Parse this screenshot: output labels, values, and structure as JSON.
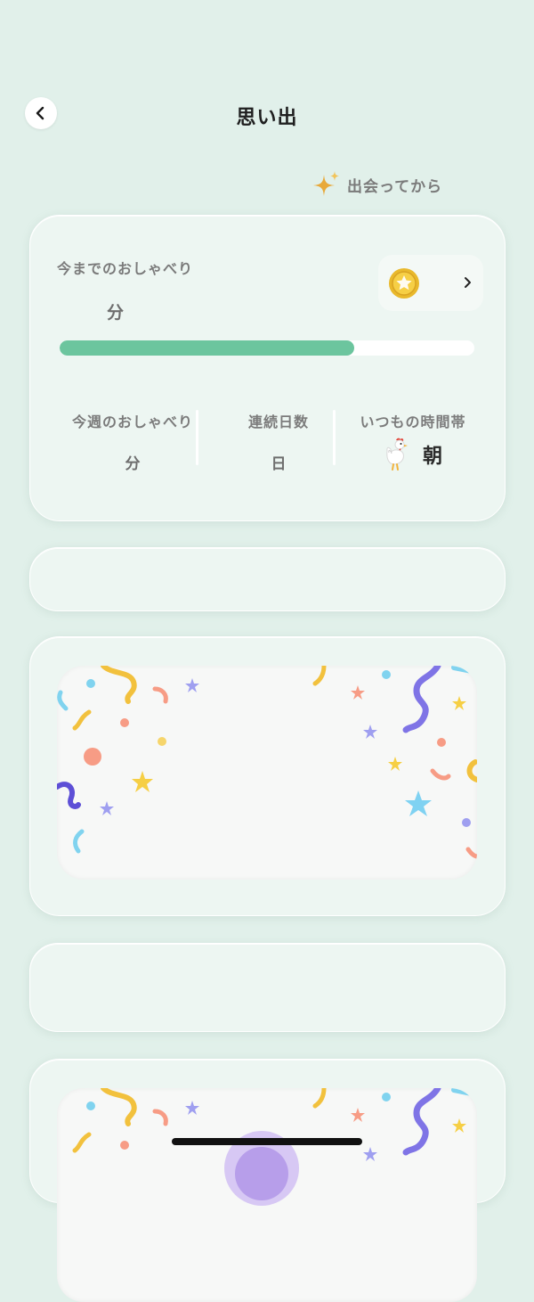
{
  "header": {
    "title": "思い出",
    "back_icon": "chevron-left-icon"
  },
  "since": {
    "label": "出会ってから",
    "icon": "sparkle-icon"
  },
  "stats_card": {
    "total_label": "今までのおしゃべり",
    "total_unit": "分",
    "coin_icon": "star-coin-icon",
    "progress_fraction": 0.71,
    "weekly": {
      "label": "今週のおしゃべり",
      "unit": "分"
    },
    "streak": {
      "label": "連続日数",
      "unit": "日"
    },
    "usual_time": {
      "label": "いつもの時間帯",
      "value": "朝",
      "icon": "rooster-icon"
    }
  },
  "colors": {
    "background": "#e1f0ea",
    "card": "#edf6f2",
    "progress": "#6cc59e",
    "sparkle": "#e8a93a"
  }
}
